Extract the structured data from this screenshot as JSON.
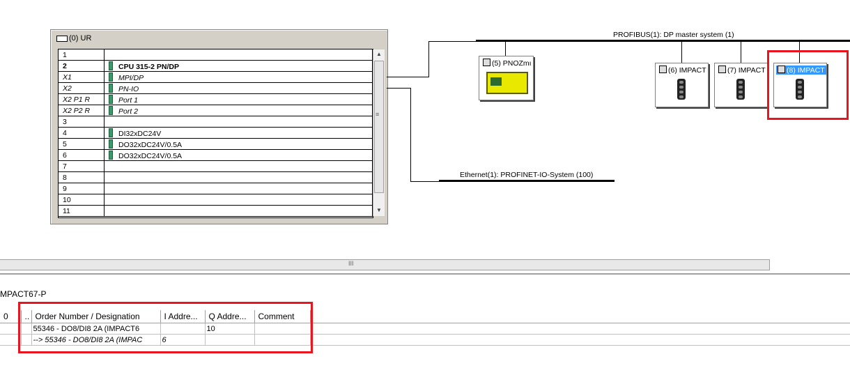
{
  "rack": {
    "title": "(0) UR",
    "rows": [
      {
        "slot": "1",
        "module": "",
        "icon": false,
        "style": ""
      },
      {
        "slot": "2",
        "module": "CPU 315-2 PN/DP",
        "icon": true,
        "style": "bold"
      },
      {
        "slot": "X1",
        "module": "MPI/DP",
        "icon": true,
        "style": "ital"
      },
      {
        "slot": "X2",
        "module": "PN-IO",
        "icon": true,
        "style": "ital"
      },
      {
        "slot": "X2 P1 R",
        "module": "Port 1",
        "icon": true,
        "style": "ital"
      },
      {
        "slot": "X2 P2 R",
        "module": "Port 2",
        "icon": true,
        "style": "ital"
      },
      {
        "slot": "3",
        "module": "",
        "icon": false,
        "style": ""
      },
      {
        "slot": "4",
        "module": "DI32xDC24V",
        "icon": true,
        "style": ""
      },
      {
        "slot": "5",
        "module": "DO32xDC24V/0.5A",
        "icon": true,
        "style": ""
      },
      {
        "slot": "6",
        "module": "DO32xDC24V/0.5A",
        "icon": true,
        "style": ""
      },
      {
        "slot": "7",
        "module": "",
        "icon": false,
        "style": ""
      },
      {
        "slot": "8",
        "module": "",
        "icon": false,
        "style": ""
      },
      {
        "slot": "9",
        "module": "",
        "icon": false,
        "style": ""
      },
      {
        "slot": "10",
        "module": "",
        "icon": false,
        "style": ""
      },
      {
        "slot": "11",
        "module": "",
        "icon": false,
        "style": ""
      }
    ]
  },
  "network": {
    "profibus_label": "PROFIBUS(1): DP master system (1)",
    "ethernet_label": "Ethernet(1): PROFINET-IO-System (100)"
  },
  "devices": [
    {
      "label": "(5) PNOZmı",
      "kind": "pnoz",
      "selected": false
    },
    {
      "label": "(6) IMPACT",
      "kind": "impact",
      "selected": false
    },
    {
      "label": "(7) IMPACT",
      "kind": "impact",
      "selected": false
    },
    {
      "label": "(8) IMPACT",
      "kind": "impact",
      "selected": true
    }
  ],
  "detail": {
    "title": "MPACT67-P",
    "columns": [
      "0",
      "..",
      "Order Number / Designation",
      "I Addre...",
      "Q Addre...",
      "Comment"
    ],
    "rows": [
      {
        "c0": "",
        "c1": "",
        "order": "55346 - DO8/DI8 2A (IMPACT6",
        "i_addr": "",
        "q_addr": "10",
        "comment": "",
        "style": ""
      },
      {
        "c0": "",
        "c1": "",
        "order": "--> 55346 - DO8/DI8 2A (IMPAC",
        "i_addr": "6",
        "q_addr": "",
        "comment": "",
        "style": "sub"
      }
    ]
  },
  "colors": {
    "highlight": "#e8141e",
    "selection": "#3399ff"
  }
}
